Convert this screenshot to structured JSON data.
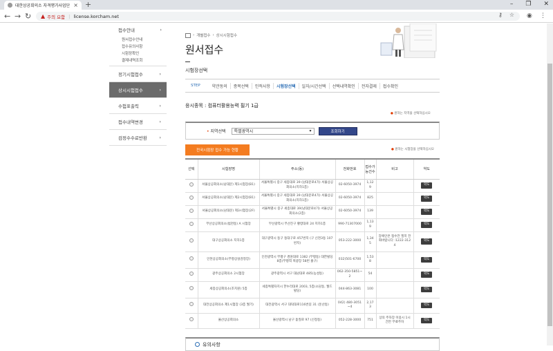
{
  "browser": {
    "tab_title": "대한상공회의소 자격평가사업단",
    "url": "license.korcham.net",
    "security_label": "주의 요함"
  },
  "sidebar": {
    "top_item": "접수안내",
    "sub_items": [
      "원서접수안내",
      "접수유의사항",
      "시험장확인",
      "결제내역조회"
    ],
    "items": [
      {
        "label": "정기시험접수",
        "active": false
      },
      {
        "label": "상시시험접수",
        "active": true
      },
      {
        "label": "수험표출력",
        "active": false
      },
      {
        "label": "접수내역변경",
        "active": false
      },
      {
        "label": "검정수수료반환",
        "active": false
      }
    ]
  },
  "breadcrumb": [
    "개별접수",
    "상시시험접수"
  ],
  "page": {
    "title": "원서접수",
    "section_title": "시험장선택"
  },
  "steps": {
    "label": "STEP",
    "items": [
      {
        "label": "약관동의",
        "active": false
      },
      {
        "label": "종목선택",
        "active": false
      },
      {
        "label": "인적사항",
        "active": false
      },
      {
        "label": "시험장선택",
        "active": true
      },
      {
        "label": "일자/시간선택",
        "active": false
      },
      {
        "label": "선택내역확인",
        "active": false
      },
      {
        "label": "전자결제",
        "active": false
      },
      {
        "label": "접수확인",
        "active": false
      }
    ]
  },
  "subject": "응시종목 : 컴퓨터활용능력 필기 1급",
  "note_region": "원하는 지역을 선택하십시오",
  "note_site": "원하는 시험장을 선택하십시오",
  "region": {
    "label": "지역선택",
    "value": "특별광역시",
    "button": "조회하기"
  },
  "status_button": "전국시험장 접수 가능 현황",
  "table": {
    "headers": [
      "선택",
      "시험장명",
      "주소(동)",
      "전화번호",
      "접수가능건수",
      "비고",
      "약도"
    ],
    "map_label": "약도",
    "rows": [
      {
        "name": "서울상공회의소(남대문) 제1시험장(B1)",
        "address": "서울특별시 중구 세종대로 39 (남대문로4가) 서울상공회의소(지하1층)",
        "phone": "02-6050-3974",
        "count": "1,129",
        "note": ""
      },
      {
        "name": "서울상공회의소(남대문) 제2시험장(B1)",
        "address": "서울특별시 중구 세종대로 39 (남대문로4가) 서울상공회의소(지하1층)",
        "phone": "02-6050-3974",
        "count": "825",
        "note": ""
      },
      {
        "name": "서울상공회의소(남대문) 제3시험장(2F)",
        "address": "서울특별시 중구 세종대로 39(남대문로4가) 서울상공회의소(2층)",
        "phone": "02-6050-3974",
        "count": "139",
        "note": ""
      },
      {
        "name": "부산상공회의소(범천동) A 시험장",
        "address": "부산광역시 부산진구 황령대로 24 지하1층",
        "phone": "990-71307000",
        "count": "1,139",
        "note": ""
      },
      {
        "name": "대구상공회의소 지하1층",
        "address": "대구광역시 동구 동대구로 457번지 (구 신천3동 107번지)",
        "phone": "053-222-3000",
        "count": "1,345",
        "note": "장애인은 접수전 필히 전화바랍니다 :1222-3124"
      },
      {
        "name": "인천상공회의소(부평상설검정장)",
        "address": "인천광역시 부평구 경원대로 1382 (부평동) 대한빌딩 8층(부평역 북광장 58번 출구)",
        "phone": "032)501-6700",
        "count": "1,538",
        "note": ""
      },
      {
        "name": "광주상공회의소 2시험장",
        "address": "광주광역시 서구 대남대로 485(농성동)",
        "phone": "062-350-5851~2",
        "count": "54",
        "note": ""
      },
      {
        "name": "세종상공회의소(조치원) 5층",
        "address": "세종특별자치시 한누리대로 2003, 5층(소담동, 월드빌딩)",
        "phone": "044-863-3081",
        "count": "100",
        "note": ""
      },
      {
        "name": "대전상공회의소 제1시험장 (3층 월기)",
        "address": "대전광역시 서구 대덕대로116번길 31 (둔산동)",
        "phone": "042) 480-3051~4",
        "count": "2,173",
        "note": ""
      },
      {
        "name": "울산상공회의소",
        "address": "울산광역시 남구 돋질로 97 (신정동)",
        "phone": "052-228-3000",
        "count": "751",
        "note": "상의 주차장 이용시 1시간만 무료주차"
      }
    ]
  },
  "guide_title": "유의사항",
  "colors": {
    "accent": "#f47c20",
    "nav_active": "#6b6b6b",
    "button": "#33478a",
    "step_active": "#2a6db5"
  }
}
